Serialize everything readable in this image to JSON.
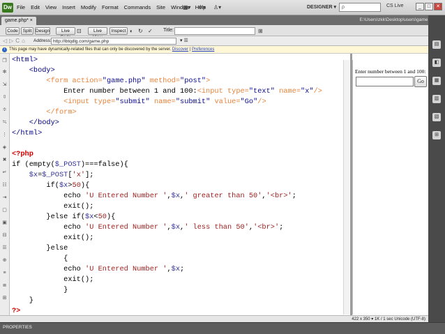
{
  "app": {
    "logo": "Dw"
  },
  "menus": [
    "File",
    "Edit",
    "View",
    "Insert",
    "Modify",
    "Format",
    "Commands",
    "Site",
    "Window",
    "Help"
  ],
  "toolbar_icons": {
    "layout": "layout-icon",
    "extend": "gear-icon",
    "site": "site-icon"
  },
  "workspace": "DESIGNER ▾",
  "search": {
    "placeholder": "ρ"
  },
  "cslive": "CS Live",
  "window_buttons": [
    "_",
    "□",
    "✕"
  ],
  "tab": {
    "name": "game.php* ×",
    "path": "E:\\Users\\zkk\\Desktop\\users\\game.php"
  },
  "view_buttons": [
    "Code",
    "Split",
    "Design",
    "Live Code",
    "Live View",
    "Inspect"
  ],
  "title_label": "Title:",
  "address": {
    "label": "Address:",
    "value": "http://lbtqdlg.com/game.php"
  },
  "info": {
    "text": "This page may have dynamically-related files that can only be discovered by the server.",
    "discover": "Discover",
    "preferences": "Preferences"
  },
  "code_lines": [
    [
      [
        "t",
        "<html>"
      ]
    ],
    [
      [
        "t",
        "    <body>"
      ]
    ],
    [
      [
        "f",
        "        <form "
      ],
      [
        "a",
        "action="
      ],
      [
        "s",
        "\"game.php\""
      ],
      [
        "a",
        " method="
      ],
      [
        "s",
        "\"post\""
      ],
      [
        "f",
        ">"
      ]
    ],
    [
      [
        "k",
        "            Enter number between 1 and 100:"
      ],
      [
        "f",
        "<input "
      ],
      [
        "a",
        "type="
      ],
      [
        "s",
        "\"text\""
      ],
      [
        "a",
        " name="
      ],
      [
        "s",
        "\"x\""
      ],
      [
        "f",
        "/>"
      ]
    ],
    [
      [
        "k",
        "            "
      ],
      [
        "f",
        "<input "
      ],
      [
        "a",
        "type="
      ],
      [
        "s",
        "\"submit\""
      ],
      [
        "a",
        " name="
      ],
      [
        "s",
        "\"submit\""
      ],
      [
        "a",
        " value="
      ],
      [
        "s",
        "\"Go\""
      ],
      [
        "f",
        "/>"
      ]
    ],
    [
      [
        "f",
        "        </form>"
      ]
    ],
    [
      [
        "t",
        "    </body>"
      ]
    ],
    [
      [
        "t",
        "</html>"
      ]
    ],
    [
      [
        "k",
        ""
      ]
    ],
    [
      [
        "p",
        "<?php"
      ]
    ],
    [
      [
        "k",
        "if (empty("
      ],
      [
        "v",
        "$_POST"
      ],
      [
        "k",
        ")===false){"
      ]
    ],
    [
      [
        "k",
        "    "
      ],
      [
        "v",
        "$x"
      ],
      [
        "k",
        "="
      ],
      [
        "v",
        "$_POST"
      ],
      [
        "k",
        "["
      ],
      [
        "q",
        "'x'"
      ],
      [
        "k",
        "];"
      ]
    ],
    [
      [
        "k",
        "        if("
      ],
      [
        "v",
        "$x"
      ],
      [
        "k",
        ">"
      ],
      [
        "q",
        "50"
      ],
      [
        "k",
        "){"
      ]
    ],
    [
      [
        "k",
        "            echo "
      ],
      [
        "q",
        "'U Entered Number '"
      ],
      [
        "k",
        ","
      ],
      [
        "v",
        "$x"
      ],
      [
        "k",
        ","
      ],
      [
        "q",
        "' greater than 50'"
      ],
      [
        "k",
        ","
      ],
      [
        "q",
        "'<br>'"
      ],
      [
        "k",
        ";"
      ]
    ],
    [
      [
        "k",
        "            exit();"
      ]
    ],
    [
      [
        "k",
        "        }else if("
      ],
      [
        "v",
        "$x"
      ],
      [
        "k",
        "<"
      ],
      [
        "q",
        "50"
      ],
      [
        "k",
        "){"
      ]
    ],
    [
      [
        "k",
        "            echo "
      ],
      [
        "q",
        "'U Entered Number '"
      ],
      [
        "k",
        ","
      ],
      [
        "v",
        "$x"
      ],
      [
        "k",
        ","
      ],
      [
        "q",
        "' less than 50'"
      ],
      [
        "k",
        ","
      ],
      [
        "q",
        "'<br>'"
      ],
      [
        "k",
        ";"
      ]
    ],
    [
      [
        "k",
        "            exit();"
      ]
    ],
    [
      [
        "k",
        "        }else"
      ]
    ],
    [
      [
        "k",
        "            {"
      ]
    ],
    [
      [
        "k",
        "            echo "
      ],
      [
        "q",
        "'U Entered Number '"
      ],
      [
        "k",
        ","
      ],
      [
        "v",
        "$x"
      ],
      [
        "k",
        ";"
      ]
    ],
    [
      [
        "k",
        "            exit();"
      ]
    ],
    [
      [
        "k",
        "            }"
      ]
    ],
    [
      [
        "k",
        "    }"
      ]
    ],
    [
      [
        "p",
        "?>"
      ]
    ]
  ],
  "design_view": {
    "label": "Enter number between 1 and 100:",
    "button": "Go"
  },
  "status": "422 x 350 ▾  1K / 1 sec  Unicode (UTF-8)",
  "properties": "PROPERTIES",
  "colors": {
    "tag": "#000080",
    "form": "#e8833a",
    "string": "#0a0a8e",
    "php": "#d40000",
    "var": "#333399"
  }
}
